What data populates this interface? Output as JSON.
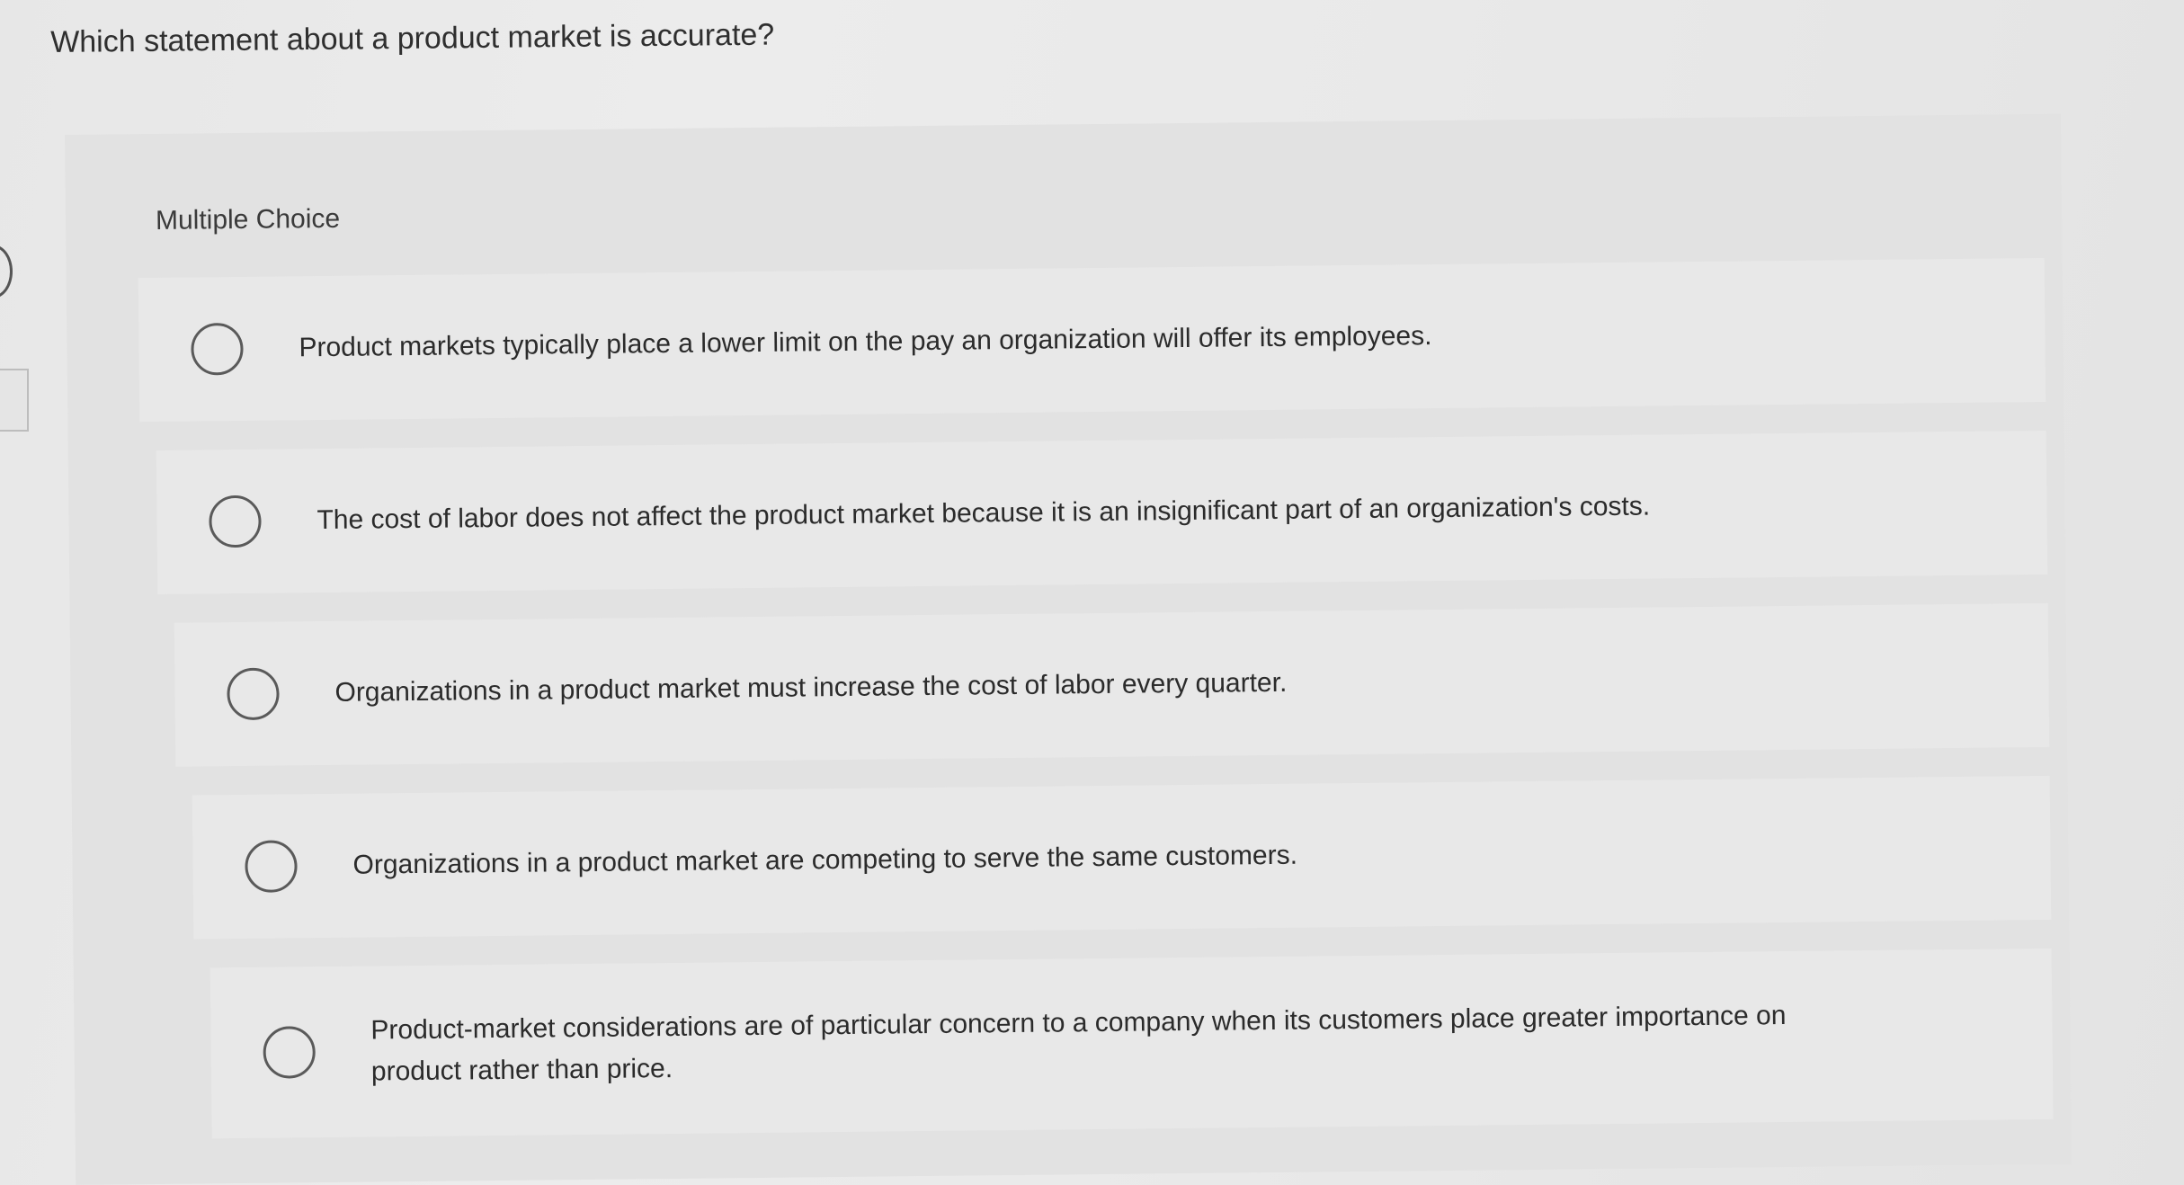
{
  "question": {
    "text": "Which statement about a product market is accurate?"
  },
  "panel": {
    "label": "Multiple Choice"
  },
  "options": [
    {
      "text": "Product markets typically place a lower limit on the pay an organization will offer its employees.",
      "selected": false
    },
    {
      "text": "The cost of labor does not affect the product market because it is an insignificant part of an organization's costs.",
      "selected": false
    },
    {
      "text": "Organizations in a product market must increase the cost of labor every quarter.",
      "selected": false
    },
    {
      "text": "Organizations in a product market are competing to serve the same customers.",
      "selected": false
    },
    {
      "text": "Product-market considerations are of particular concern to a company when its customers place greater importance on product rather than price.",
      "selected": false
    }
  ]
}
